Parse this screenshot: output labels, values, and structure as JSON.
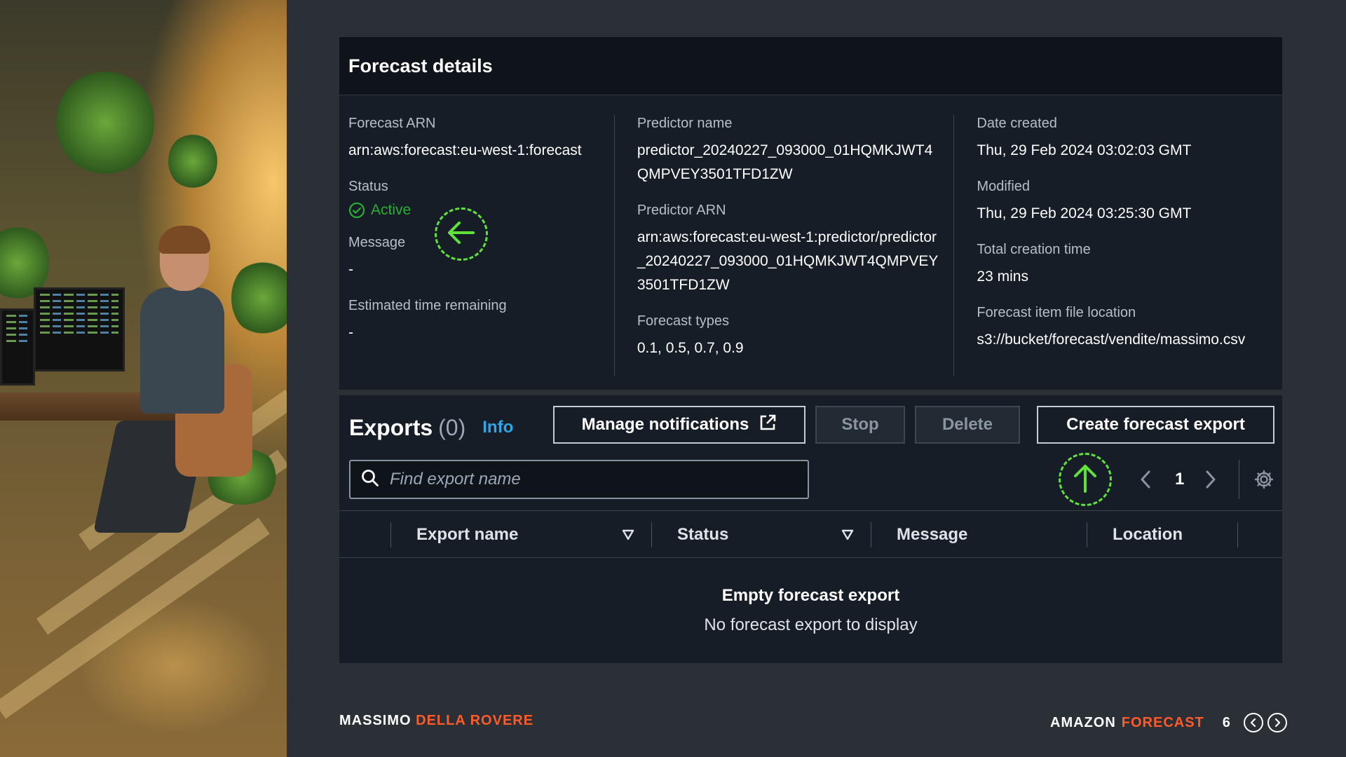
{
  "forecast_details": {
    "title": "Forecast details",
    "forecast_arn_label": "Forecast ARN",
    "forecast_arn_value": "arn:aws:forecast:eu-west-1:forecast",
    "status_label": "Status",
    "status_value": "Active",
    "message_label": "Message",
    "message_value": "-",
    "eta_label": "Estimated time remaining",
    "eta_value": "-",
    "predictor_name_label": "Predictor name",
    "predictor_name_value": "predictor_20240227_093000_01HQMKJWT4QMPVEY3501TFD1ZW",
    "predictor_arn_label": "Predictor ARN",
    "predictor_arn_value": "arn:aws:forecast:eu-west-1:predictor/predictor_20240227_093000_01HQMKJWT4QMPVEY3501TFD1ZW",
    "forecast_types_label": "Forecast types",
    "forecast_types_value": "0.1, 0.5, 0.7, 0.9",
    "date_created_label": "Date created",
    "date_created_value": "Thu, 29 Feb 2024 03:02:03 GMT",
    "modified_label": "Modified",
    "modified_value": "Thu, 29 Feb 2024 03:25:30 GMT",
    "total_creation_label": "Total creation time",
    "total_creation_value": "23 mins",
    "item_file_label": "Forecast item file location",
    "item_file_value": "s3://bucket/forecast/vendite/massimo.csv"
  },
  "exports": {
    "title": "Exports",
    "count": "(0)",
    "info_label": "Info",
    "manage_notifications_label": "Manage notifications",
    "stop_label": "Stop",
    "delete_label": "Delete",
    "create_label": "Create forecast export",
    "search_placeholder": "Find export name",
    "page_number": "1",
    "columns": [
      "Export name",
      "Status",
      "Message",
      "Location"
    ],
    "empty_title": "Empty forecast export",
    "empty_subtitle": "No forecast export to display"
  },
  "footer": {
    "author_first": "MASSIMO",
    "author_last": "DELLA ROVERE",
    "product_first": "AMAZON",
    "product_last": "FORECAST",
    "slide_number": "6"
  },
  "colors": {
    "accent": "#ff5a2a",
    "status_active": "#29ad32",
    "info_link": "#2ea6e8",
    "callout": "#5fe33a"
  },
  "icons": {
    "status": "check-circle-icon",
    "external_link": "external-link-icon",
    "search": "search-icon",
    "settings": "gear-icon",
    "callout_left": "arrow-left-icon",
    "callout_up": "arrow-up-icon"
  }
}
